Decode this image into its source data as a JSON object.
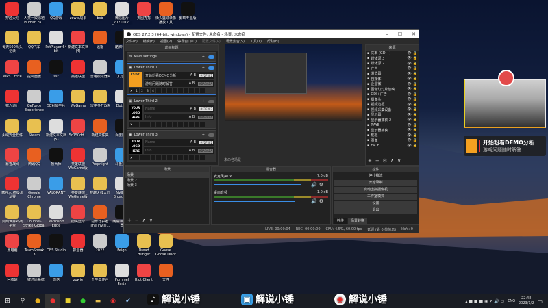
{
  "desktop_icons": [
    [
      "穿越火线",
      "人类一败涂地 Human Fa...",
      "QQ游戏",
      "zowie战事",
      "bsb",
      "微信图片_2021072...",
      "美图秀秀",
      "街头篮球录像播放工具",
      "剪映专业版"
    ],
    [
      "每天500元头记录",
      "QQ飞车",
      "PotPlayer 64 bit",
      "新建文本文档(4)",
      "迅雷",
      "酷狗音乐"
    ],
    [
      "WPS Office",
      "控制面板",
      "ssr",
      "英雄联盟",
      "雷电模拟器4",
      "QQ音乐"
    ],
    [
      "犯人追行",
      "GeForce Experience",
      "5E对战平台",
      "WeGame",
      "雷电多开器4",
      "Dota 2"
    ],
    [
      "火绒安全软件",
      "Steam",
      "新建文本文档(5)",
      "5c150dd...",
      "新建文件夹",
      "百度网盘"
    ],
    [
      "暴雪战网",
      "腾讯QQ",
      "鲁大师",
      "英雄联盟WeGame版",
      "Propnight",
      "斗鱼直播"
    ],
    [
      "糖豆人:终极淘汰赛",
      "Google Chrome",
      "VALORANT",
      "英雄联盟WeGame版",
      "穿越火线大厅",
      "NVIDIA Broadcast"
    ],
    [
      "剑网世界对战平台",
      "Counter-Strike Global Off...",
      "Microsoft Edge",
      "街头篮球",
      "隐形守护者 The Invisi...",
      "网易UU加速器"
    ],
    [
      "此电脑",
      "TeamSpeak 3",
      "OBS Studio",
      "抓包器",
      "2022",
      "Feign",
      "Dread Hunger",
      "Goose Goose Duck"
    ],
    [
      "回收站",
      "一键还原系统",
      "微信",
      "zowie",
      "千牛工作台",
      "Pummel Party",
      "Riot Client",
      "文件"
    ]
  ],
  "obs": {
    "title": "OBS 27.2.3 (64-bit, windows) - 配置文件: 未命名 - 场景: 未命名",
    "menu": [
      "文件(F)",
      "编辑(E)",
      "视图(V)",
      "停靠窗口(D)",
      "配置文件(P)",
      "场景集合(S)",
      "工具(T)",
      "帮助(H)"
    ],
    "lower_thirds_dock": {
      "title": "动画标题",
      "main_settings": "Main settings",
      "items": [
        {
          "name": "Lower Third 1",
          "line1": "开始粉看DEMO分析",
          "line2": "游戏问题随时解答",
          "color1": "#F2F2F2",
          "color2": "#BABABA",
          "logo": "CS:GO",
          "slots": [
            "1",
            "2",
            "3",
            "4"
          ]
        },
        {
          "name": "Lower Third 2",
          "line1": "Name",
          "line2": "Info",
          "color1": "#F2F2F2",
          "color2": "#BABABA",
          "logo": "YOUR LOGO HERE"
        },
        {
          "name": "Lower Third 3",
          "line1": "Name",
          "line2": "Info",
          "color1": "#F2F2F2",
          "color2": "#BABABA",
          "logo": "YOUR LOGO HERE"
        }
      ]
    },
    "preview_label": "未命名场景",
    "sources": {
      "title": "来源",
      "items": [
        "文本 (GDI+)",
        "媒体源 3",
        "媒体源 2",
        "广告",
        "浏览器",
        "自媒体",
        "企业微",
        "图像幻灯片放映",
        "GDI+广告",
        "摄像头",
        "视频边框",
        "视频采集设备",
        "显示器",
        "显示器捕获 2",
        "RAYE",
        "显示器捕获",
        "框框",
        "图像",
        "FACE"
      ]
    },
    "scenes": {
      "title": "场景",
      "items": [
        "场景",
        "场景 2",
        "场景 3"
      ]
    },
    "mixer": {
      "title": "混音器",
      "channels": [
        {
          "name": "麦克风/Aux",
          "db": "7.0 dB",
          "level": 0.95
        },
        {
          "name": "桌面音频",
          "db": "-1.0 dB",
          "level": 0.88
        }
      ]
    },
    "controls": {
      "title": "控件",
      "buttons": [
        "停止推流",
        "开始录制",
        "启动虚拟摄像机",
        "工作室模式",
        "设置",
        "退出"
      ],
      "tabs": [
        "控件",
        "场景转换"
      ]
    },
    "status": {
      "live": "LIVE: 00:00:04",
      "rec": "REC: 00:00:00",
      "cpu": "CPU: 4.5%, 60.00 fps",
      "delay": "延迟 (丢 0 帧信息)",
      "kbps": "kb/s: 0"
    }
  },
  "overlay": {
    "title": "开始粉看DEMO分析",
    "subtitle": "游戏问题随时解答",
    "logo": "CS:GO"
  },
  "watermarks": [
    "解说小锤",
    "解说小锤",
    "解说小锤"
  ],
  "tray": {
    "lang": "ENG",
    "time": "22:48",
    "date": "2023/1/2"
  }
}
